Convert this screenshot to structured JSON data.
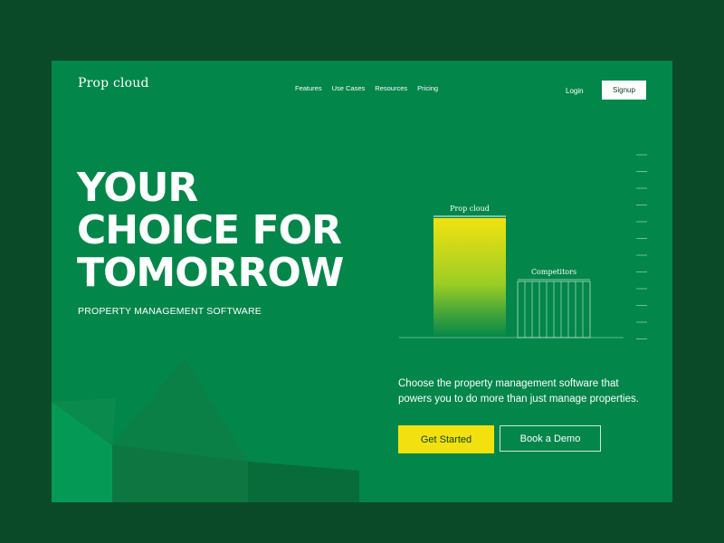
{
  "brand": {
    "logo_text": "Prop cloud"
  },
  "nav": {
    "items": [
      "Features",
      "Use Cases",
      "Resources",
      "Pricing"
    ]
  },
  "auth": {
    "login_label": "Login",
    "signup_label": "Signup"
  },
  "hero": {
    "headline": [
      "YOUR",
      "CHOICE FOR",
      "TOMORROW"
    ],
    "subtitle": "PROPERTY MANAGEMENT SOFTWARE",
    "description": "Choose the property management software that powers you to do more than just manage properties.",
    "cta_primary": "Get Started",
    "cta_secondary": "Book a Demo"
  },
  "chart_data": {
    "type": "bar",
    "categories": [
      "Prop cloud",
      "Competitors"
    ],
    "values": [
      1.0,
      0.47
    ],
    "title": "",
    "xlabel": "",
    "ylabel": ""
  },
  "colors": {
    "page_bg": "#0b4a28",
    "frame_bg": "#02864a",
    "accent": "#f2e10f"
  }
}
